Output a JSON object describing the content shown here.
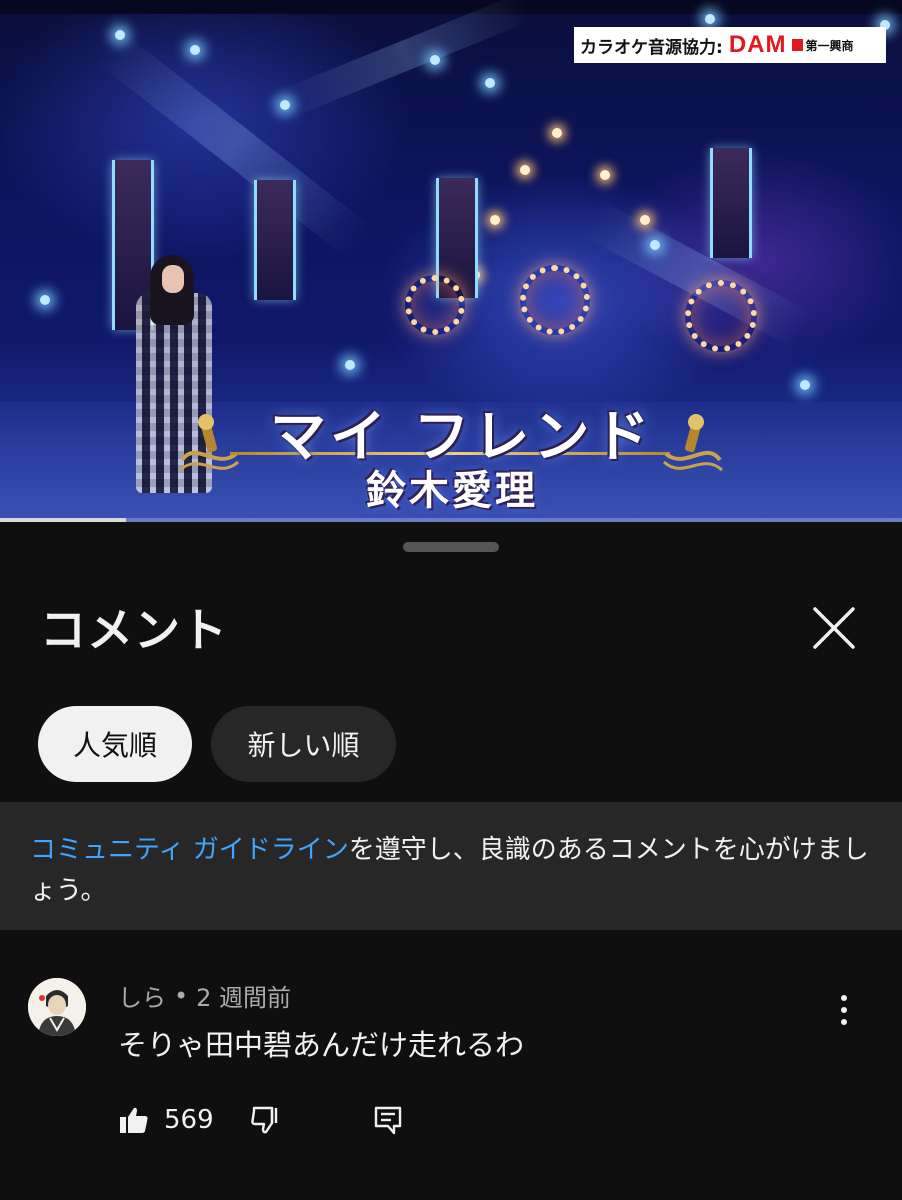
{
  "video": {
    "badge_label": "カラオケ音源協力:",
    "badge_brand": "DAM",
    "badge_company": "第一興商",
    "song_title": "マイ フレンド",
    "artist": "鈴木愛理",
    "progress": 0.14
  },
  "sheet": {
    "title": "コメント",
    "close_icon": "close-icon"
  },
  "sort_chips": [
    {
      "label": "人気順",
      "selected": true
    },
    {
      "label": "新しい順",
      "selected": false
    }
  ],
  "guideline": {
    "link_text": "コミュニティ ガイドライン",
    "text": "を遵守し、良識のあるコメントを心がけましょう。"
  },
  "comments": [
    {
      "author": "しら",
      "separator": "•",
      "time": "2 週間前",
      "text": "そりゃ田中碧あんだけ走れるわ",
      "likes": "569"
    }
  ],
  "colors": {
    "background": "#0f0f0f",
    "surface": "#272727",
    "link": "#3ea6ff",
    "text": "#f1f1f1",
    "secondary_text": "#aaaaaa",
    "brand_red": "#e0191f"
  }
}
